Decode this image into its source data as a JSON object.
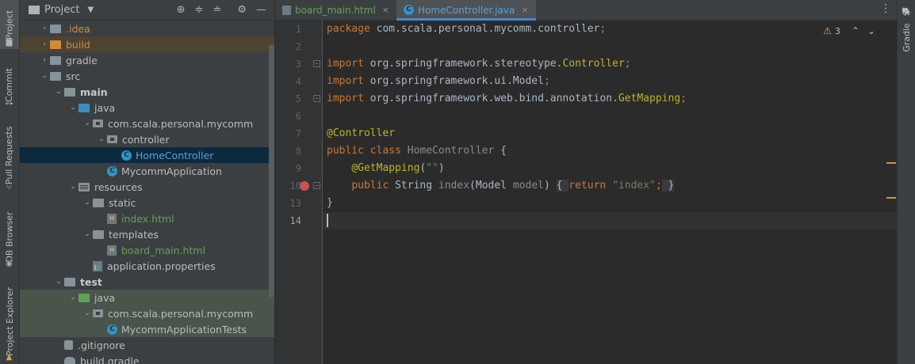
{
  "left_strip": {
    "tabs": [
      {
        "label": "Project",
        "icon": "folder-icon",
        "active": true
      },
      {
        "label": "Commit",
        "icon": "commit-icon"
      },
      {
        "label": "Pull Requests",
        "icon": "pull-request-icon"
      },
      {
        "label": "DB Browser",
        "icon": "database-icon"
      },
      {
        "label": "Project Explorer",
        "icon": "explorer-icon"
      }
    ]
  },
  "project_panel": {
    "title": "Project",
    "toolbar_icons": [
      "locate-icon",
      "expand-all-icon",
      "collapse-all-icon",
      "settings-icon",
      "hide-icon"
    ],
    "tree": [
      {
        "label": ".idea",
        "depth": 1,
        "arrow": "›",
        "icon": "gray",
        "style": "orange"
      },
      {
        "label": "build",
        "depth": 1,
        "arrow": "›",
        "icon": "orange",
        "style": "orange",
        "bg": "builddir"
      },
      {
        "label": "gradle",
        "depth": 1,
        "arrow": "›",
        "icon": "gray"
      },
      {
        "label": "src",
        "depth": 1,
        "arrow": "⌄",
        "icon": "gray"
      },
      {
        "label": "main",
        "depth": 2,
        "arrow": "⌄",
        "icon": "gray",
        "style": "bold"
      },
      {
        "label": "java",
        "depth": 3,
        "arrow": "⌄",
        "icon": "blue"
      },
      {
        "label": "com.scala.personal.mycomm",
        "depth": 4,
        "arrow": "⌄",
        "icon": "pkg"
      },
      {
        "label": "controller",
        "depth": 5,
        "arrow": "⌄",
        "icon": "pkg"
      },
      {
        "label": "HomeController",
        "depth": 6,
        "arrow": "",
        "icon": "class",
        "style": "blue",
        "bg": "sel"
      },
      {
        "label": "MycommApplication",
        "depth": 5,
        "arrow": "",
        "icon": "class"
      },
      {
        "label": "resources",
        "depth": 3,
        "arrow": "⌄",
        "icon": "res"
      },
      {
        "label": "static",
        "depth": 4,
        "arrow": "⌄",
        "icon": "gray"
      },
      {
        "label": "index.html",
        "depth": 5,
        "arrow": "",
        "icon": "html",
        "style": "green"
      },
      {
        "label": "templates",
        "depth": 4,
        "arrow": "⌄",
        "icon": "gray"
      },
      {
        "label": "board_main.html",
        "depth": 5,
        "arrow": "",
        "icon": "html",
        "style": "green"
      },
      {
        "label": "application.properties",
        "depth": 4,
        "arrow": "",
        "icon": "props"
      },
      {
        "label": "test",
        "depth": 2,
        "arrow": "⌄",
        "icon": "gray",
        "style": "bold"
      },
      {
        "label": "java",
        "depth": 3,
        "arrow": "⌄",
        "icon": "green",
        "bg": "testbg"
      },
      {
        "label": "com.scala.personal.mycomm",
        "depth": 4,
        "arrow": "⌄",
        "icon": "pkg",
        "bg": "testbg"
      },
      {
        "label": "MycommApplicationTests",
        "depth": 5,
        "arrow": "",
        "icon": "class",
        "bg": "testbg"
      },
      {
        "label": ".gitignore",
        "depth": 2,
        "arrow": "",
        "icon": "git"
      },
      {
        "label": "build.gradle",
        "depth": 2,
        "arrow": "",
        "icon": "gradle"
      }
    ]
  },
  "editor": {
    "tabs": [
      {
        "label": "board_main.html",
        "icon": "html-file-icon",
        "active": false,
        "close": "×"
      },
      {
        "label": "HomeController.java",
        "icon": "java-class-icon",
        "active": true,
        "close": "×"
      }
    ],
    "more_icon": "⋮",
    "inspection": {
      "icon": "warning-icon",
      "count": "3"
    },
    "lines": [
      {
        "n": "1",
        "tokens": [
          [
            "kw",
            "package "
          ],
          [
            "",
            "com.scala.personal.mycomm.controller"
          ],
          [
            "kw",
            ";"
          ]
        ]
      },
      {
        "n": "2",
        "tokens": []
      },
      {
        "n": "3",
        "fold": true,
        "tokens": [
          [
            "kw",
            "import "
          ],
          [
            "",
            "org.springframework.stereotype."
          ],
          [
            "ann",
            "Controller"
          ],
          [
            "kw",
            ";"
          ]
        ]
      },
      {
        "n": "4",
        "tokens": [
          [
            "kw",
            "import "
          ],
          [
            "",
            "org.springframework.ui.Model"
          ],
          [
            "kw",
            ";"
          ]
        ]
      },
      {
        "n": "5",
        "fold": true,
        "tokens": [
          [
            "kw",
            "import "
          ],
          [
            "",
            "org.springframework.web.bind.annotation."
          ],
          [
            "ann",
            "GetMapping"
          ],
          [
            "kw",
            ";"
          ]
        ]
      },
      {
        "n": "6",
        "tokens": []
      },
      {
        "n": "7",
        "tokens": [
          [
            "ann",
            "@Controller"
          ]
        ]
      },
      {
        "n": "8",
        "tokens": [
          [
            "kw",
            "public class "
          ],
          [
            "dim",
            "HomeController "
          ],
          [
            "",
            "{"
          ]
        ]
      },
      {
        "n": "9",
        "tokens": [
          [
            "",
            "    "
          ],
          [
            "ann",
            "@GetMapping"
          ],
          [
            "",
            "("
          ],
          [
            "str",
            "\"\""
          ],
          [
            "",
            ")"
          ]
        ]
      },
      {
        "n": "10",
        "breakpoint": true,
        "fold": true,
        "tokens": [
          [
            "",
            "    "
          ],
          [
            "kw",
            "public "
          ],
          [
            "",
            "String "
          ],
          [
            "dim",
            "index"
          ],
          [
            "",
            "(Model "
          ],
          [
            "dim",
            "model"
          ],
          [
            "",
            ") "
          ],
          [
            "inl",
            "{ "
          ],
          [
            "kw",
            "return "
          ],
          [
            "str",
            "\"index\""
          ],
          [
            "kw",
            ";"
          ],
          [
            "inl",
            " }"
          ]
        ]
      },
      {
        "n": "13",
        "tokens": [
          [
            "",
            "}"
          ]
        ]
      },
      {
        "n": "14",
        "current": true,
        "tokens": []
      }
    ]
  },
  "right_strip": {
    "tabs": [
      {
        "label": "Gradle",
        "icon": "gradle-elephant-icon"
      }
    ]
  }
}
